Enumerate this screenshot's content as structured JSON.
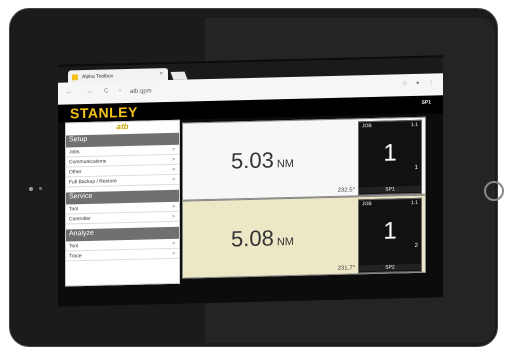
{
  "browser": {
    "tab_title": "Alpha Toolbox",
    "tab_close": "×",
    "back": "←",
    "forward": "→",
    "reload": "C",
    "url": "atb.qpm",
    "right_icons": "☆ ✦ ⋮"
  },
  "header": {
    "brand": "STANLEY",
    "spindle_label": "SP1"
  },
  "sidebar": {
    "logo": "atb",
    "sections": [
      {
        "title": "Setup",
        "items": [
          {
            "label": "Jobs",
            "chevron": ">"
          },
          {
            "label": "Communications",
            "chevron": ">"
          },
          {
            "label": "Other",
            "chevron": ">"
          },
          {
            "label": "Full Backup / Restore",
            "chevron": ">"
          }
        ]
      },
      {
        "title": "Service",
        "items": [
          {
            "label": "Tool",
            "chevron": ">"
          },
          {
            "label": "Controller",
            "chevron": ">"
          }
        ]
      },
      {
        "title": "Analyze",
        "items": [
          {
            "label": "Tool",
            "chevron": ">"
          },
          {
            "label": "Trace",
            "chevron": ">"
          }
        ]
      }
    ]
  },
  "results": [
    {
      "torque": "5.03",
      "unit": "NM",
      "angle": "232.5°",
      "job_label": "JOB",
      "job_id": "1.1",
      "job_number": "1",
      "count": "1",
      "spindle": "SP1"
    },
    {
      "torque": "5.08",
      "unit": "NM",
      "angle": "231.7°",
      "job_label": "JOB",
      "job_id": "1.1",
      "job_number": "1",
      "count": "2",
      "spindle": "SP2"
    }
  ],
  "colors": {
    "brand_yellow": "#f4c21a",
    "pass_panel": "#ece8c6",
    "section_header": "#707070"
  }
}
